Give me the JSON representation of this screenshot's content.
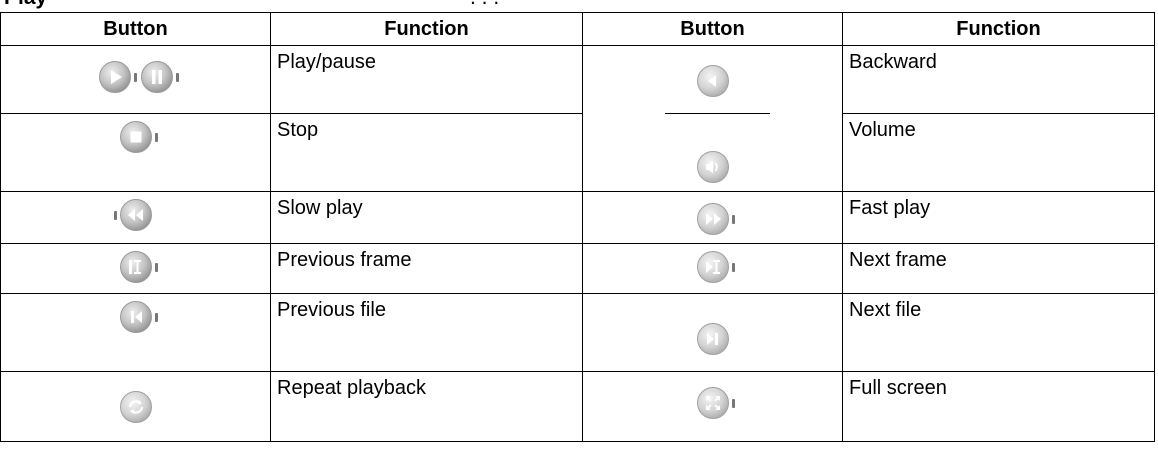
{
  "header": {
    "col1": "Button",
    "col2": "Function",
    "col3": "Button",
    "col4": "Function"
  },
  "rows": [
    {
      "left": {
        "icons": [
          "play-icon",
          "pause-icon"
        ],
        "function": "Play/pause"
      },
      "right": {
        "icons": [
          "backward-icon"
        ],
        "function": "Backward"
      }
    },
    {
      "left": {
        "icons": [
          "stop-icon"
        ],
        "function": "Stop"
      },
      "right": {
        "icons": [
          "volume-icon"
        ],
        "function": "Volume"
      }
    },
    {
      "left": {
        "icons": [
          "slow-play-icon"
        ],
        "function": "Slow play"
      },
      "right": {
        "icons": [
          "fast-play-icon"
        ],
        "function": "Fast play"
      }
    },
    {
      "left": {
        "icons": [
          "previous-frame-icon"
        ],
        "function": "Previous frame"
      },
      "right": {
        "icons": [
          "next-frame-icon"
        ],
        "function": "Next frame"
      }
    },
    {
      "left": {
        "icons": [
          "previous-file-icon"
        ],
        "function": "Previous file"
      },
      "right": {
        "icons": [
          "next-file-icon"
        ],
        "function": "Next file"
      }
    },
    {
      "left": {
        "icons": [
          "repeat-playback-icon"
        ],
        "function": "Repeat playback"
      },
      "right": {
        "icons": [
          "full-screen-icon"
        ],
        "function": "Full screen"
      }
    }
  ]
}
